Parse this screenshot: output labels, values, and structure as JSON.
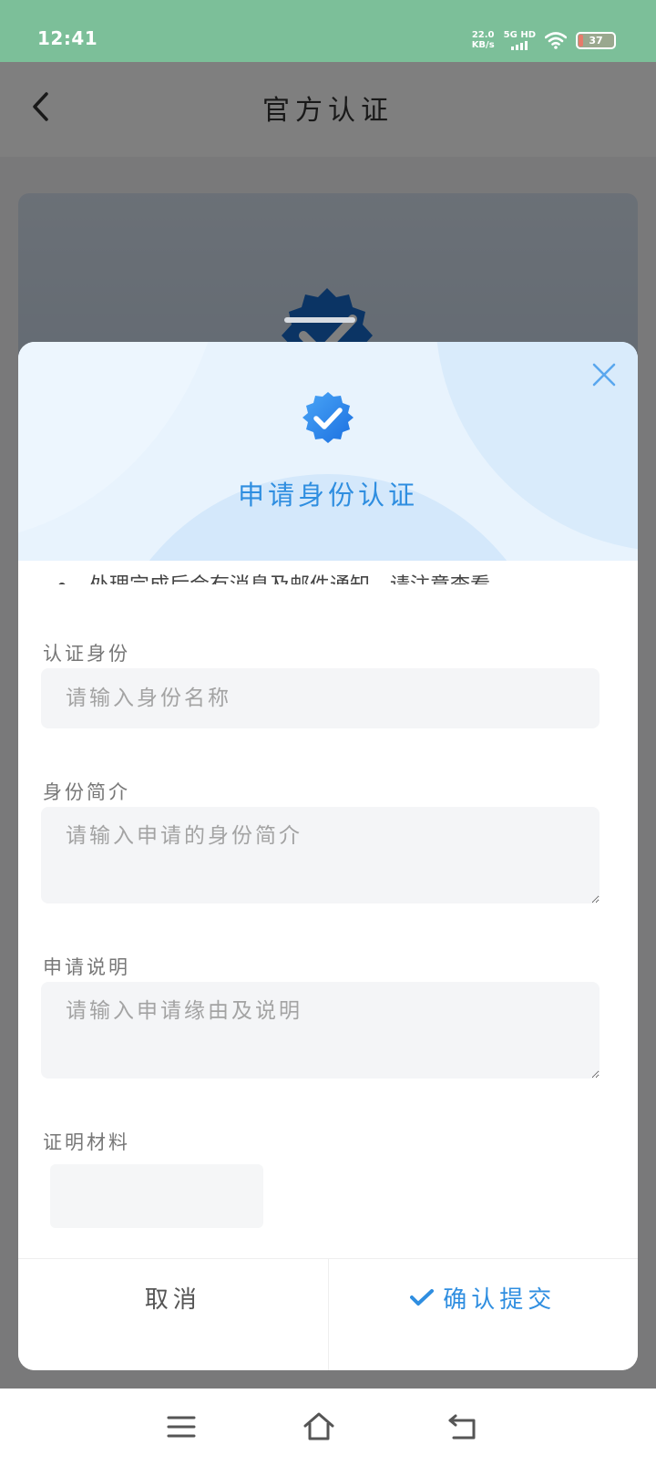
{
  "status_bar": {
    "time": "12:41",
    "net_speed_value": "22.0",
    "net_speed_unit": "KB/s",
    "network_type": "5G HD",
    "battery": "37",
    "icons": [
      "signal-bars-icon",
      "wifi-icon",
      "battery-icon"
    ]
  },
  "header": {
    "title": "官方认证",
    "back_icon": "chevron-left-icon"
  },
  "modal": {
    "title": "申请身份认证",
    "close_icon": "close-icon",
    "badge_icon": "verified-badge-icon",
    "truncated_notice": "处理完成后会有消息及邮件通知，请注意查看",
    "fields": [
      {
        "label": "认证身份",
        "placeholder": "请输入身份名称"
      },
      {
        "label": "身份简介",
        "placeholder": "请输入申请的身份简介"
      },
      {
        "label": "申请说明",
        "placeholder": "请输入申请缘由及说明"
      },
      {
        "label": "证明材料"
      }
    ],
    "cancel_label": "取消",
    "confirm_label": "确认提交"
  },
  "colors": {
    "status_bar": "#7cbf99",
    "accent": "#2f8ee0",
    "hero_bg": "#e8f3fd"
  },
  "nav_bar": {
    "icons": [
      "menu-icon",
      "home-icon",
      "back-return-icon"
    ]
  }
}
